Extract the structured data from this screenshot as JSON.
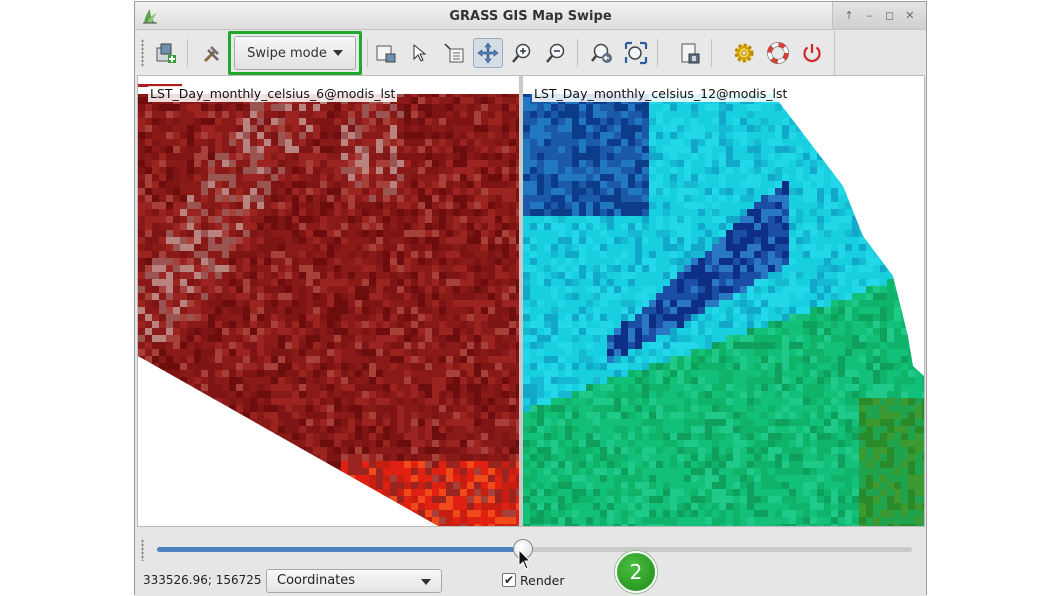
{
  "window": {
    "title": "GRASS GIS Map Swipe"
  },
  "title_controls": [
    "↑",
    "–",
    "◻",
    "✕"
  ],
  "toolbar": {
    "swipe_mode_label": "Swipe mode",
    "highlight_color": "#1fa82b"
  },
  "maps": {
    "left_layer": "LST_Day_monthly_celsius_6@modis_lst",
    "right_layer": "LST_Day_monthly_celsius_12@modis_lst"
  },
  "slider": {
    "fraction": 0.485,
    "fill_color": "#4d83c0"
  },
  "status": {
    "coordinates": "333526.96; 156725",
    "display_mode": "Coordinates",
    "render_label": "Render",
    "render_checked": "✔"
  },
  "annotation": {
    "step_number": "2"
  }
}
